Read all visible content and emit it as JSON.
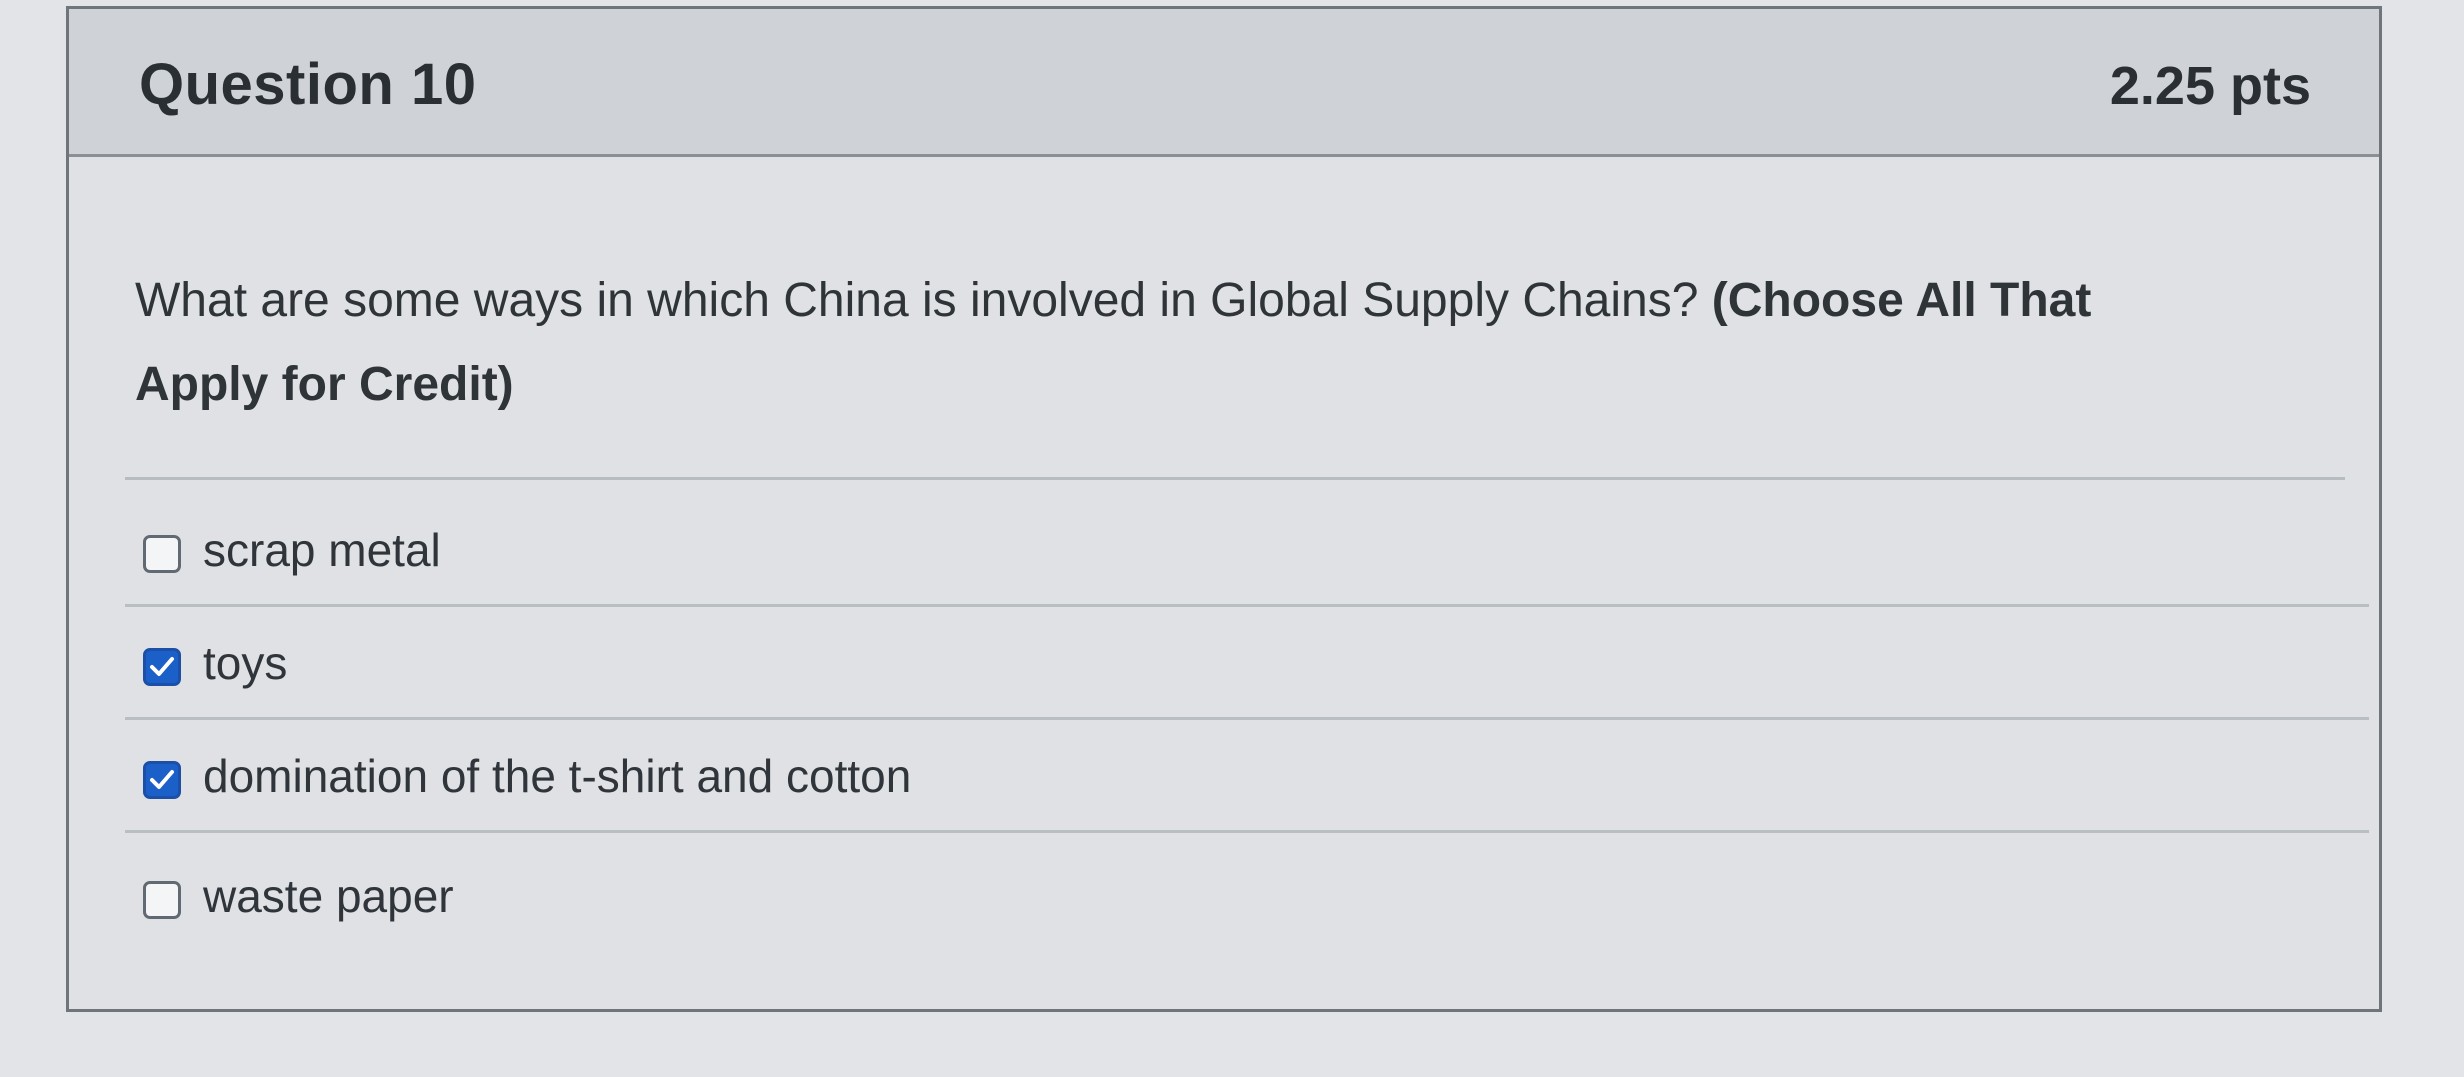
{
  "question": {
    "title": "Question 10",
    "points": "2.25 pts",
    "text": "What are some ways in which China is involved in Global Supply Chains?",
    "instruction_line1": "(Choose All That",
    "instruction_line2": "Apply for Credit)"
  },
  "answers": [
    {
      "label": "scrap metal",
      "checked": false
    },
    {
      "label": "toys",
      "checked": true
    },
    {
      "label": "domination of the t-shirt and cotton",
      "checked": true
    },
    {
      "label": "waste paper",
      "checked": false
    }
  ],
  "colors": {
    "checkbox_checked": "#1b5fc8",
    "header_bg": "#cfd2d6",
    "card_bg": "#dfe1e4"
  }
}
